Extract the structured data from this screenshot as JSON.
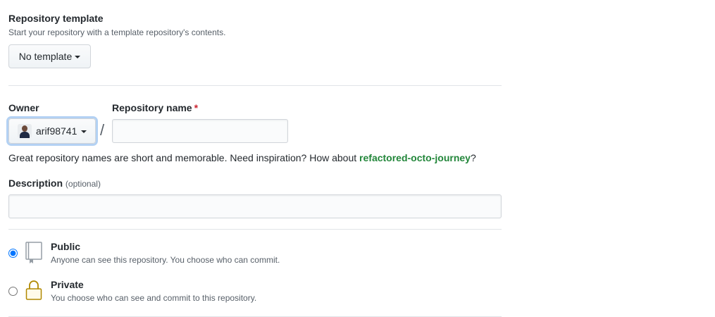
{
  "template": {
    "title": "Repository template",
    "description": "Start your repository with a template repository's contents.",
    "button_label": "No template"
  },
  "owner": {
    "label": "Owner",
    "selected": "arif98741"
  },
  "repo_name": {
    "label": "Repository name",
    "required_mark": "*",
    "value": "",
    "separator": "/"
  },
  "hint": {
    "text": "Great repository names are short and memorable. Need inspiration? How about ",
    "suggestion": "refactored-octo-journey",
    "suffix": "?"
  },
  "description": {
    "label": "Description",
    "optional": "(optional)",
    "value": ""
  },
  "visibility": {
    "public": {
      "title": "Public",
      "subtitle": "Anyone can see this repository. You choose who can commit.",
      "checked": true
    },
    "private": {
      "title": "Private",
      "subtitle": "You choose who can see and commit to this repository.",
      "checked": false
    }
  },
  "colors": {
    "suggestion": "#22863a",
    "required": "#cb2431",
    "border": "#d1d5da",
    "divider": "#e1e4e8"
  }
}
